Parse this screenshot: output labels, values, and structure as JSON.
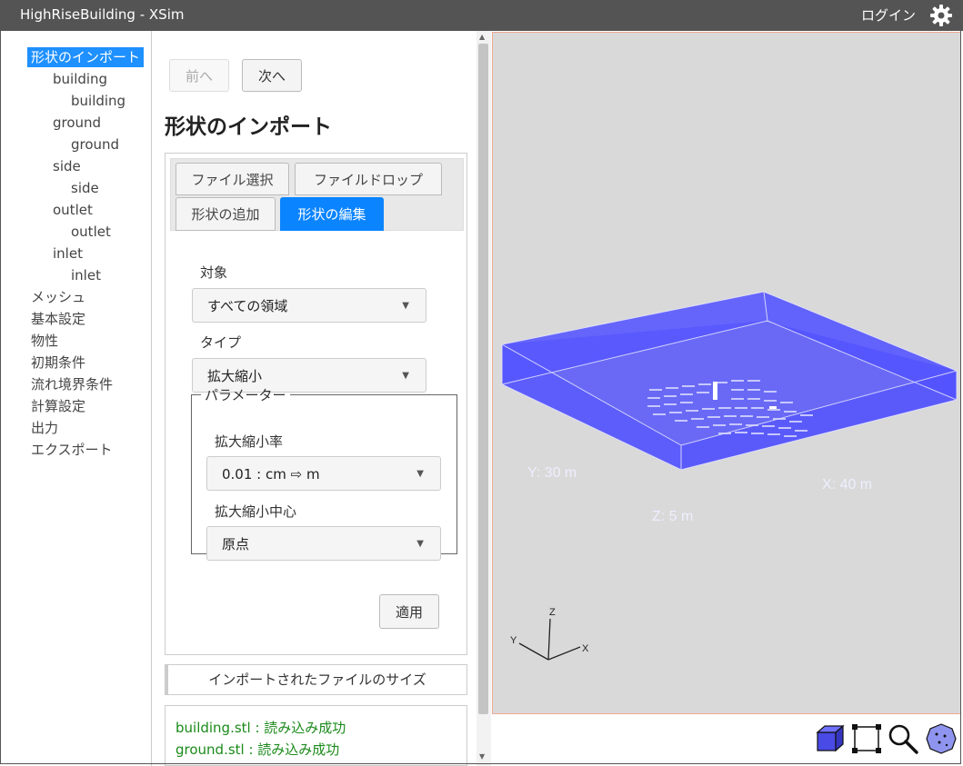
{
  "app": {
    "title": "HighRiseBuilding - XSim",
    "login_label": "ログイン",
    "settings_icon": "gear-icon"
  },
  "tree": [
    {
      "label": "形状のインポート",
      "level": 0,
      "selected": true
    },
    {
      "label": "building",
      "level": 1
    },
    {
      "label": "building",
      "level": 2
    },
    {
      "label": "ground",
      "level": 1
    },
    {
      "label": "ground",
      "level": 2
    },
    {
      "label": "side",
      "level": 1
    },
    {
      "label": "side",
      "level": 2
    },
    {
      "label": "outlet",
      "level": 1
    },
    {
      "label": "outlet",
      "level": 2
    },
    {
      "label": "inlet",
      "level": 1
    },
    {
      "label": "inlet",
      "level": 2
    },
    {
      "label": "メッシュ",
      "level": 0
    },
    {
      "label": "基本設定",
      "level": 0
    },
    {
      "label": "物性",
      "level": 0
    },
    {
      "label": "初期条件",
      "level": 0
    },
    {
      "label": "流れ境界条件",
      "level": 0
    },
    {
      "label": "計算設定",
      "level": 0
    },
    {
      "label": "出力",
      "level": 0
    },
    {
      "label": "エクスポート",
      "level": 0
    }
  ],
  "nav": {
    "prev_label": "前へ",
    "next_label": "次へ"
  },
  "page_title": "形状のインポート",
  "tabs": [
    {
      "label": "ファイル選択",
      "active": false
    },
    {
      "label": "ファイルドロップ",
      "active": false
    },
    {
      "label": "形状の追加",
      "active": false
    },
    {
      "label": "形状の編集",
      "active": true
    }
  ],
  "form": {
    "target_label": "対象",
    "target_value": "すべての領域",
    "type_label": "タイプ",
    "type_value": "拡大縮小",
    "params_legend": "パラメーター",
    "scale_label": "拡大縮小率",
    "scale_value": "0.01 : cm ⇨ m",
    "center_label": "拡大縮小中心",
    "center_value": "原点",
    "apply_label": "適用"
  },
  "imported_size_label": "インポートされたファイルのサイズ",
  "results": [
    "building.stl : 読み込み成功",
    "ground.stl : 読み込み成功"
  ],
  "viewport": {
    "dim_y": "Y: 30 m",
    "dim_x": "X: 40 m",
    "dim_z": "Z: 5 m",
    "axis_x": "X",
    "axis_y": "Y",
    "axis_z": "Z",
    "box_color": "#5a5aff"
  },
  "toolbar": [
    "solid-view-icon",
    "fit-view-icon",
    "zoom-icon",
    "reset-view-icon"
  ]
}
